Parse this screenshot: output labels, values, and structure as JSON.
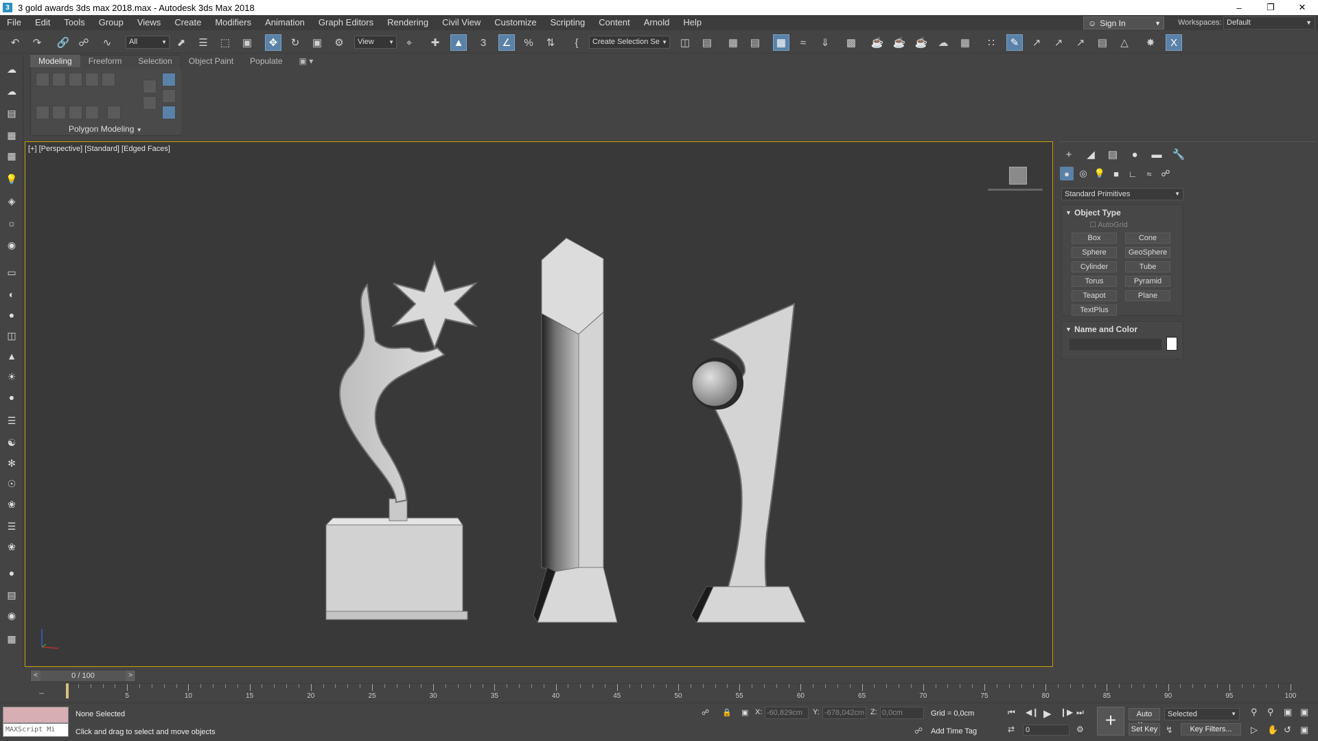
{
  "title": "3 gold awards 3ds max 2018.max - Autodesk 3ds Max 2018",
  "menu": [
    "File",
    "Edit",
    "Tools",
    "Group",
    "Views",
    "Create",
    "Modifiers",
    "Animation",
    "Graph Editors",
    "Rendering",
    "Civil View",
    "Customize",
    "Scripting",
    "Content",
    "Arnold",
    "Help"
  ],
  "signin": "Sign In",
  "workspaces_label": "Workspaces:",
  "workspaces_value": "Default",
  "toolbar": {
    "filter": "All",
    "ref_coord": "View",
    "selection_set": "Create Selection Se"
  },
  "ribbon": {
    "tabs": [
      "Modeling",
      "Freeform",
      "Selection",
      "Object Paint",
      "Populate"
    ],
    "active_tab": "Modeling",
    "panel_label": "Polygon Modeling"
  },
  "viewport": {
    "label": "[+] [Perspective] [Standard] [Edged Faces]"
  },
  "command_panel": {
    "category": "Standard Primitives",
    "object_type_title": "Object Type",
    "autogrid": "AutoGrid",
    "primitives": [
      "Box",
      "Cone",
      "Sphere",
      "GeoSphere",
      "Cylinder",
      "Tube",
      "Torus",
      "Pyramid",
      "Teapot",
      "Plane",
      "TextPlus"
    ],
    "name_color_title": "Name and Color",
    "object_color": "#ffffff"
  },
  "timeline": {
    "slider": "0 / 100",
    "ticks": [
      "5",
      "10",
      "15",
      "20",
      "25",
      "30",
      "35",
      "40",
      "45",
      "50",
      "55",
      "60",
      "65",
      "70",
      "75",
      "80",
      "85",
      "90",
      "95",
      "100"
    ]
  },
  "status": {
    "maxscript": "MAXScript Mi",
    "selection": "None Selected",
    "prompt": "Click and drag to select and move objects",
    "x_label": "X:",
    "x_value": "-60,829cm",
    "y_label": "Y:",
    "y_value": "-678,042cm",
    "z_label": "Z:",
    "z_value": "0,0cm",
    "grid": "Grid = 0,0cm",
    "add_time_tag": "Add Time Tag",
    "frame": "0",
    "auto_key": "Auto Key",
    "set_key": "Set Key",
    "key_mode": "Selected",
    "key_filters": "Key Filters..."
  }
}
